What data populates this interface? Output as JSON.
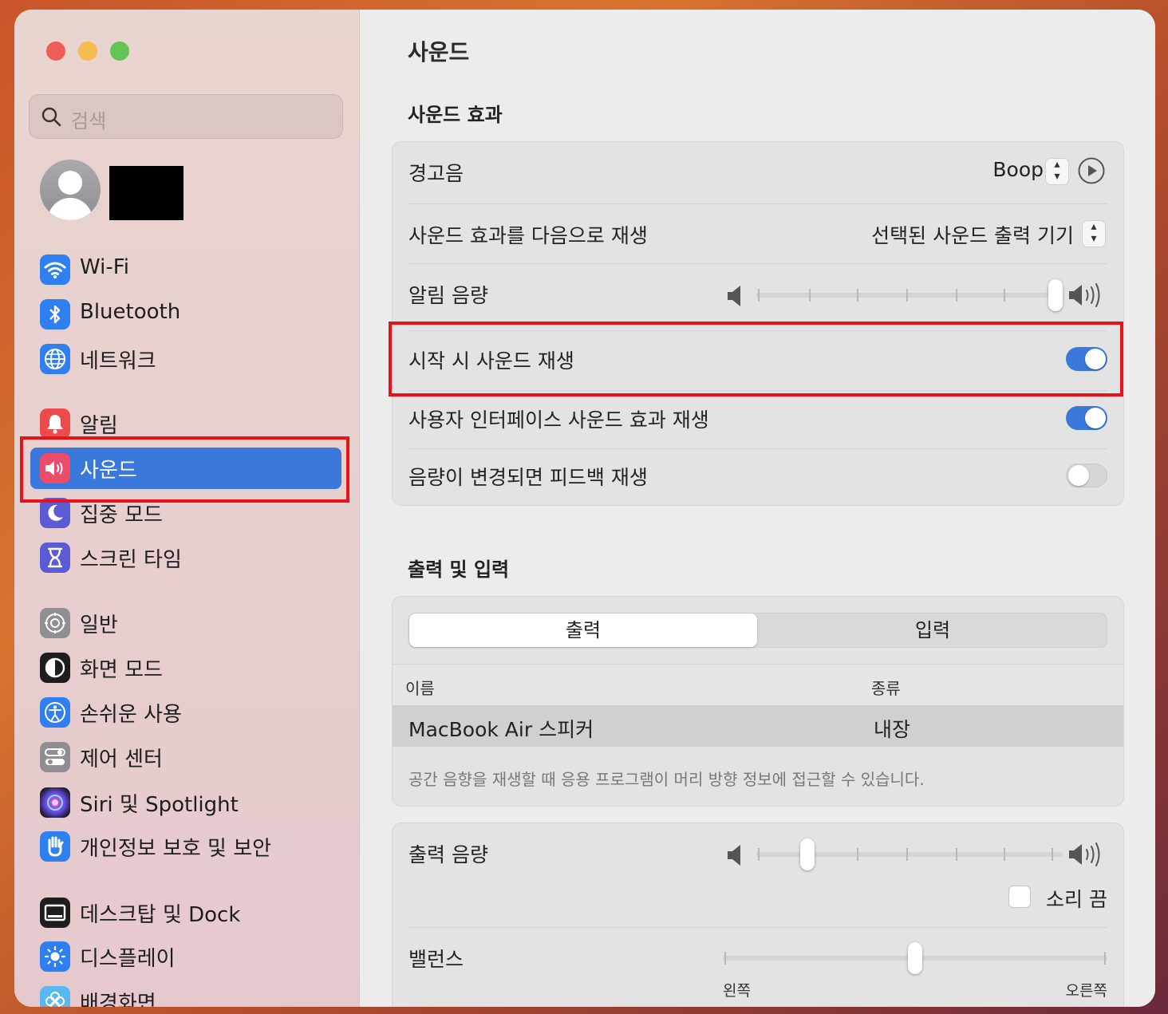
{
  "sidebar": {
    "search_placeholder": "검색",
    "items": [
      {
        "label": "Wi-Fi"
      },
      {
        "label": "Bluetooth"
      },
      {
        "label": "네트워크"
      },
      {
        "label": "알림"
      },
      {
        "label": "사운드"
      },
      {
        "label": "집중 모드"
      },
      {
        "label": "스크린 타임"
      },
      {
        "label": "일반"
      },
      {
        "label": "화면 모드"
      },
      {
        "label": "손쉬운 사용"
      },
      {
        "label": "제어 센터"
      },
      {
        "label": "Siri 및 Spotlight"
      },
      {
        "label": "개인정보 보호 및 보안"
      },
      {
        "label": "데스크탑 및 Dock"
      },
      {
        "label": "디스플레이"
      },
      {
        "label": "배경화면"
      }
    ],
    "selected": "사운드"
  },
  "main": {
    "title": "사운드",
    "effects": {
      "heading": "사운드 효과",
      "alert_sound_label": "경고음",
      "alert_sound_value": "Boop",
      "play_effects_label": "사운드 효과를 다음으로 재생",
      "play_effects_value": "선택된 사운드 출력 기기",
      "alert_volume_label": "알림 음량",
      "alert_volume_level": 1.0,
      "startup_label": "시작 시 사운드 재생",
      "startup_on": true,
      "ui_sounds_label": "사용자 인터페이스 사운드 효과 재생",
      "ui_sounds_on": true,
      "feedback_label": "음량이 변경되면 피드백 재생",
      "feedback_on": false
    },
    "output_input": {
      "heading": "출력 및 입력",
      "tabs": [
        "출력",
        "입력"
      ],
      "selected_tab": "출력",
      "columns": [
        "이름",
        "종류"
      ],
      "rows": [
        [
          "MacBook Air 스피커",
          "내장"
        ]
      ],
      "note": "공간 음향을 재생할 때 응용 프로그램이 머리 방향 정보에 접근할 수 있습니다."
    },
    "output": {
      "volume_label": "출력 음량",
      "volume_level": 0.15,
      "mute_label": "소리 끔",
      "muted": false,
      "balance_label": "밸런스",
      "balance_left": "왼쪽",
      "balance_right": "오른쪽",
      "balance_value": 0.5
    }
  },
  "colors": {
    "accent": "#3b78db",
    "highlight_box": "#e8121b",
    "close": "#ee5e57",
    "minimize": "#f5bd4f",
    "zoom": "#61c454"
  }
}
